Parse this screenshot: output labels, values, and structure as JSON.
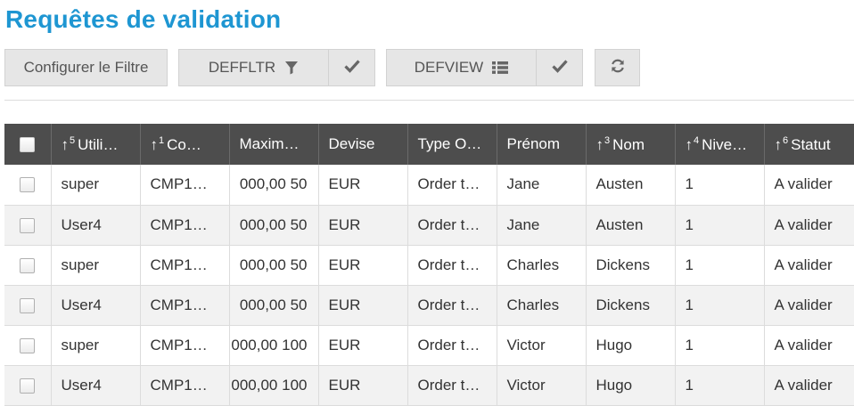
{
  "page": {
    "title": "Requêtes de validation"
  },
  "toolbar": {
    "configure_filter": "Configurer le Filtre",
    "filter_name": "DEFFLTR",
    "view_name": "DEFVIEW",
    "icons": {
      "filter": "funnel-icon",
      "apply": "checkmark-icon",
      "view": "list-icon",
      "refresh": "refresh-icon"
    }
  },
  "table": {
    "columns": [
      {
        "arrow": "↑",
        "order": "5",
        "label": "Utili…"
      },
      {
        "arrow": "↑",
        "order": "1",
        "label": "Co…"
      },
      {
        "arrow": "",
        "order": "",
        "label": "Maxim…"
      },
      {
        "arrow": "",
        "order": "",
        "label": "Devise"
      },
      {
        "arrow": "",
        "order": "",
        "label": "Type O…"
      },
      {
        "arrow": "",
        "order": "",
        "label": "Prénom"
      },
      {
        "arrow": "↑",
        "order": "3",
        "label": "Nom"
      },
      {
        "arrow": "↑",
        "order": "4",
        "label": "Nive…"
      },
      {
        "arrow": "↑",
        "order": "6",
        "label": "Statut"
      }
    ],
    "rows": [
      {
        "user": "super",
        "company": "CMP1…",
        "maximum": "50 000,00",
        "currency": "EUR",
        "type": "Order t…",
        "first_name": "Jane",
        "last_name": "Austen",
        "level": "1",
        "status": "A valider"
      },
      {
        "user": "User4",
        "company": "CMP1…",
        "maximum": "50 000,00",
        "currency": "EUR",
        "type": "Order t…",
        "first_name": "Jane",
        "last_name": "Austen",
        "level": "1",
        "status": "A valider"
      },
      {
        "user": "super",
        "company": "CMP1…",
        "maximum": "50 000,00",
        "currency": "EUR",
        "type": "Order t…",
        "first_name": "Charles",
        "last_name": "Dickens",
        "level": "1",
        "status": "A valider"
      },
      {
        "user": "User4",
        "company": "CMP1…",
        "maximum": "50 000,00",
        "currency": "EUR",
        "type": "Order t…",
        "first_name": "Charles",
        "last_name": "Dickens",
        "level": "1",
        "status": "A valider"
      },
      {
        "user": "super",
        "company": "CMP1…",
        "maximum": "100 000,00",
        "currency": "EUR",
        "type": "Order t…",
        "first_name": "Victor",
        "last_name": "Hugo",
        "level": "1",
        "status": "A valider"
      },
      {
        "user": "User4",
        "company": "CMP1…",
        "maximum": "100 000,00",
        "currency": "EUR",
        "type": "Order t…",
        "first_name": "Victor",
        "last_name": "Hugo",
        "level": "1",
        "status": "A valider"
      }
    ]
  }
}
